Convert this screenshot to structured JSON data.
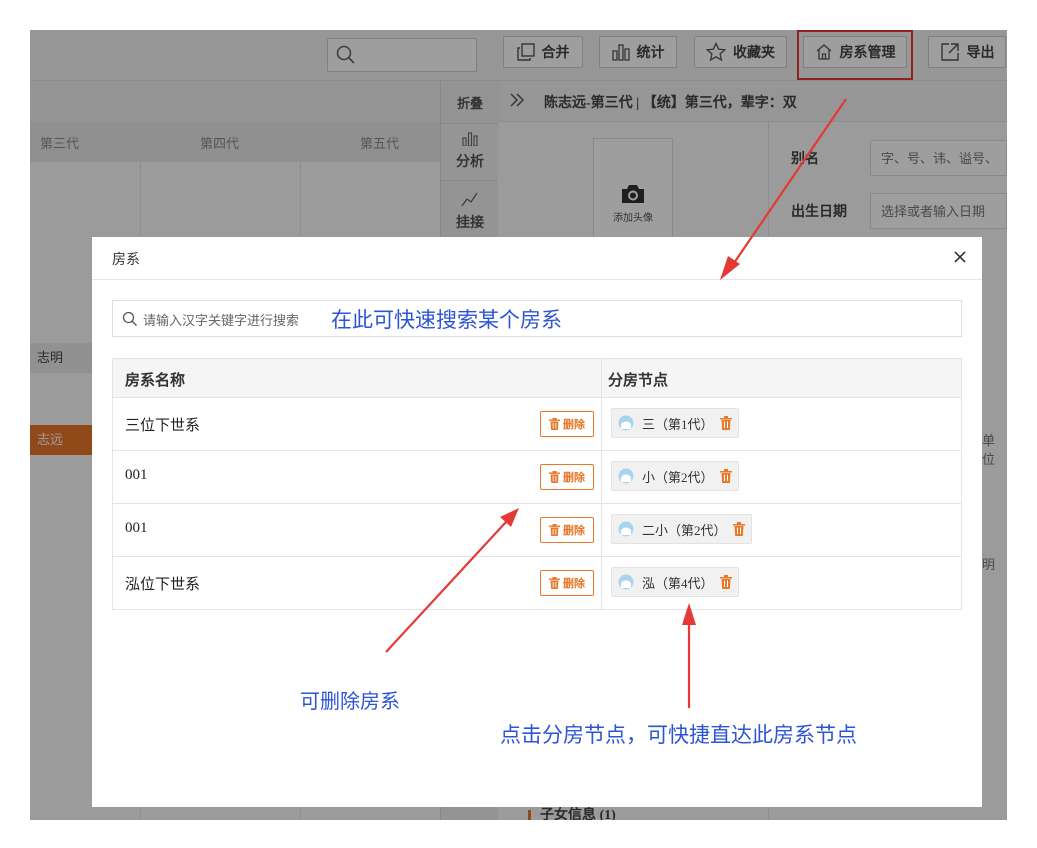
{
  "toolbar": {
    "merge": "合并",
    "stats": "统计",
    "favorites": "收藏夹",
    "branch_manage": "房系管理",
    "export": "导出"
  },
  "generations": [
    "第三代",
    "第四代",
    "第五代"
  ],
  "tree_nodes": [
    "志明",
    "志远"
  ],
  "side_tools": {
    "collapse": "折叠",
    "analyze": "分析",
    "attach": "挂接"
  },
  "person": {
    "header": "陈志远-第三代 | 【统】第三代，辈字：双",
    "add_avatar": "添加头像",
    "alias_label": "别名",
    "alias_placeholder": "字、号、讳、谥号、",
    "birth_label": "出生日期",
    "birth_placeholder": "选择或者输入日期",
    "frag_unit": "单位",
    "frag_ming": "明",
    "children": "子女信息 (1)"
  },
  "modal": {
    "title": "房系",
    "search_placeholder": "请输入汉字关键字进行搜索",
    "col_name": "房系名称",
    "col_node": "分房节点",
    "delete_label": "删除",
    "rows": [
      {
        "name": "三位下世系",
        "node": "三（第1代）"
      },
      {
        "name": "001",
        "node": "小（第2代）"
      },
      {
        "name": "001",
        "node": "二小（第2代）"
      },
      {
        "name": "泓位下世系",
        "node": "泓（第4代）"
      }
    ]
  },
  "annotations": {
    "search_hint": "在此可快速搜索某个房系",
    "delete_hint": "可删除房系",
    "node_hint": "点击分房节点，可快捷直达此房系节点"
  },
  "colors": {
    "accent_orange": "#e8782a",
    "highlight_red": "#e53935",
    "annotation_blue": "#2d54d6"
  }
}
